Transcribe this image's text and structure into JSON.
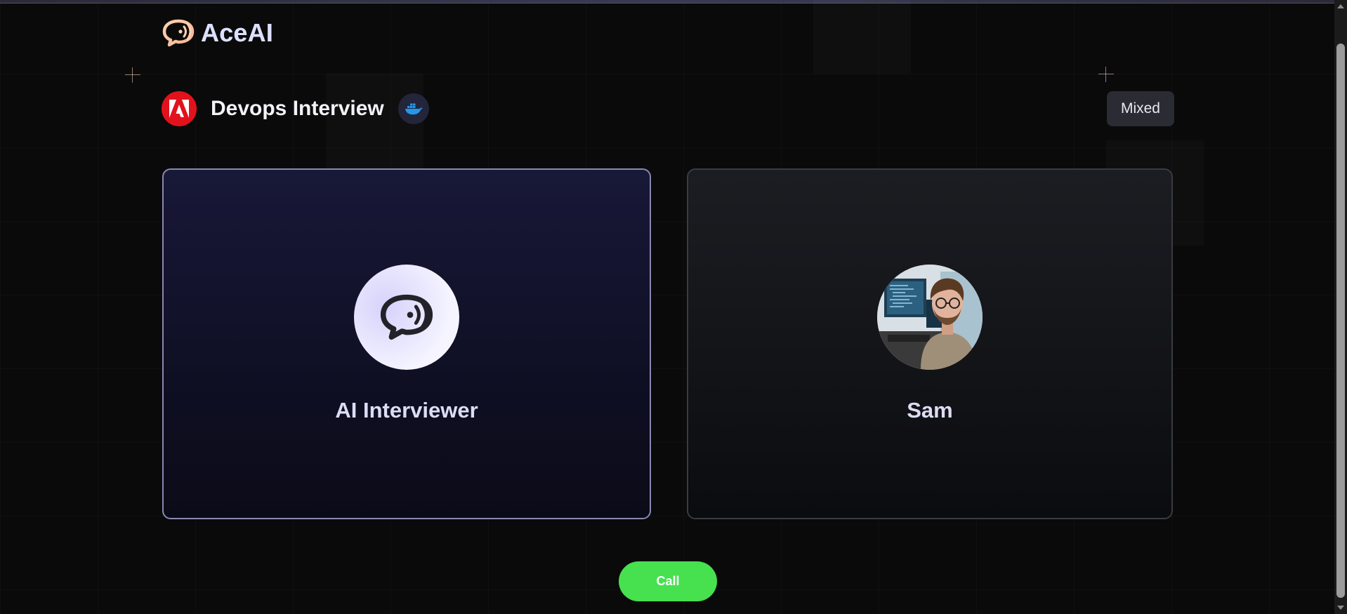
{
  "app": {
    "name": "AceAI",
    "logo_icon": "chat-voice-icon"
  },
  "interview": {
    "title": "Devops Interview",
    "company_icon": "adobe-logo-icon",
    "tech_icon": "docker-icon",
    "mode": "Mixed"
  },
  "participants": [
    {
      "name": "AI Interviewer",
      "avatar_icon": "chat-voice-icon"
    },
    {
      "name": "Sam",
      "avatar_icon": "user-photo"
    }
  ],
  "actions": {
    "call_label": "Call"
  },
  "colors": {
    "accent_green": "#47e04f",
    "company_red": "#e2121c",
    "ai_card_border": "#8a87b3",
    "background": "#0a0a0a"
  }
}
